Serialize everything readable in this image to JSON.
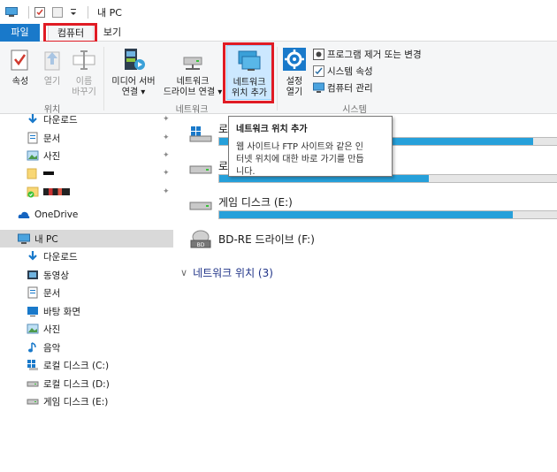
{
  "titlebar": {
    "title": "내 PC"
  },
  "ribbon_tabs": {
    "file": "파일",
    "computer": "컴퓨터",
    "view": "보기"
  },
  "ribbon": {
    "location": {
      "properties": "속성",
      "open": "열기",
      "rename_line1": "이름",
      "rename_line2": "바꾸기",
      "group_label": "위치"
    },
    "network": {
      "media_line1": "미디어 서버",
      "media_line2": "연결",
      "map_line1": "네트워크",
      "map_line2": "드라이브 연결",
      "add_line1": "네트워크",
      "add_line2": "위치 추가",
      "group_label": "네트워크"
    },
    "system": {
      "settings_line1": "설정",
      "settings_line2": "열기",
      "uninstall": "프로그램 제거 또는 변경",
      "sys_props": "시스템 속성",
      "manage": "컴퓨터 관리",
      "group_label": "시스템"
    },
    "dropdown_glyph": "▾"
  },
  "nav": {
    "quick_access": [
      {
        "label": "다운로드",
        "pinned": true
      },
      {
        "label": "문서",
        "pinned": true
      },
      {
        "label": "사진",
        "pinned": true
      },
      {
        "label": "",
        "pinned": true
      },
      {
        "label": "",
        "pinned": true
      }
    ],
    "onedrive": "OneDrive",
    "this_pc": "내 PC",
    "this_pc_items": [
      "다운로드",
      "동영상",
      "문서",
      "바탕 화면",
      "사진",
      "음악",
      "로컬 디스크 (C:)",
      "로컬 디스크 (D:)",
      "게임 디스크 (E:)"
    ]
  },
  "content": {
    "drives": [
      {
        "name": "로",
        "used_fraction": 0.93
      },
      {
        "name": "로",
        "used_fraction": 0.62
      },
      {
        "name": "게임 디스크 (E:)",
        "used_fraction": 0.87
      }
    ],
    "optical": {
      "name": "BD-RE 드라이브 (F:)",
      "badge": "BD"
    },
    "network_locations_header": "네트워크 위치 (3)",
    "chevron": "∨"
  },
  "tooltip": {
    "title": "네트워크 위치 추가",
    "body_line1": "웹 사이트나 FTP 사이트와 같은 인",
    "body_line2": "터넷 위치에 대한 바로 가기를 만듭",
    "body_line3": "니다."
  },
  "colors": {
    "accent": "#1979ca",
    "highlight": "#e01b24",
    "progress": "#26a0da"
  }
}
